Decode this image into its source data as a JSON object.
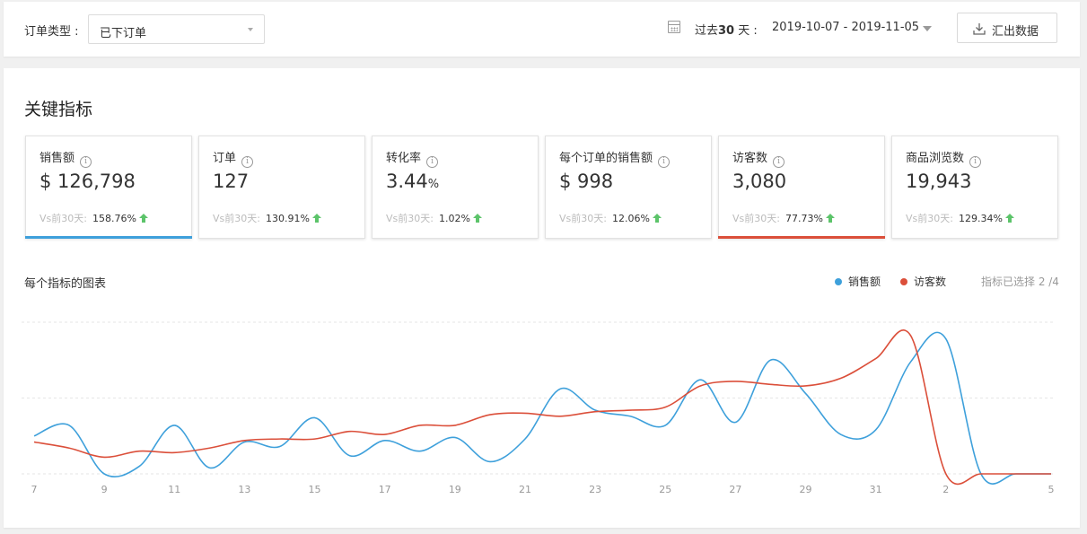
{
  "topbar": {
    "order_type_label": "订单类型 :",
    "order_type_value": "已下订单",
    "range_prefix": "过去",
    "range_days": "30",
    "range_suffix": " 天 :",
    "date_range": "2019-10-07 - 2019-11-05",
    "export_label": "汇出数据"
  },
  "section_title": "关键指标",
  "cards": [
    {
      "name": "销售额",
      "value": "$ 126,798",
      "unit": "",
      "compare_prefix": "Vs前30天:",
      "compare_pct": "158.76%",
      "selected": true,
      "accent": "#3ea0db"
    },
    {
      "name": "订单",
      "value": "127",
      "unit": "",
      "compare_prefix": "Vs前30天:",
      "compare_pct": "130.91%",
      "selected": false,
      "accent": ""
    },
    {
      "name": "转化率",
      "value": "3.44",
      "unit": "%",
      "compare_prefix": "Vs前30天:",
      "compare_pct": "1.02%",
      "selected": false,
      "accent": ""
    },
    {
      "name": "每个订单的销售额",
      "value": "$ 998",
      "unit": "",
      "compare_prefix": "Vs前30天:",
      "compare_pct": "12.06%",
      "selected": false,
      "accent": ""
    },
    {
      "name": "访客数",
      "value": "3,080",
      "unit": "",
      "compare_prefix": "Vs前30天:",
      "compare_pct": "77.73%",
      "selected": true,
      "accent": "#db4f3a"
    },
    {
      "name": "商品浏览数",
      "value": "19,943",
      "unit": "",
      "compare_prefix": "Vs前30天:",
      "compare_pct": "129.34%",
      "selected": false,
      "accent": ""
    }
  ],
  "colors": {
    "up_arrow": "#5cc46a",
    "sales": "#3ea0db",
    "visitors": "#db4f3a",
    "grid": "#e6e6e6"
  },
  "chart_title": "每个指标的图表",
  "selection_count": "指标已选择 2 /4",
  "chart_data": {
    "type": "line",
    "title": "每个指标的图表",
    "x": [
      "7",
      "8",
      "9",
      "10",
      "11",
      "12",
      "13",
      "14",
      "15",
      "16",
      "17",
      "18",
      "19",
      "20",
      "21",
      "22",
      "23",
      "24",
      "25",
      "26",
      "27",
      "28",
      "29",
      "30",
      "31",
      "1",
      "2",
      "3",
      "4",
      "5"
    ],
    "x_tick_labels": [
      "7",
      "9",
      "11",
      "13",
      "15",
      "17",
      "19",
      "21",
      "23",
      "25",
      "27",
      "29",
      "31",
      "2",
      "5"
    ],
    "ylim": [
      0,
      100
    ],
    "grid": true,
    "legend_position": "top-right",
    "y_axis_labels_shown": false,
    "series": [
      {
        "name": "销售额",
        "color": "#3ea0db",
        "values": [
          25,
          32,
          0,
          5,
          32,
          4,
          21,
          18,
          37,
          12,
          22,
          15,
          24,
          8,
          23,
          56,
          42,
          38,
          32,
          62,
          34,
          75,
          53,
          26,
          29,
          74,
          89,
          0,
          0,
          0
        ]
      },
      {
        "name": "访客数",
        "color": "#db4f3a",
        "values": [
          21,
          17,
          11,
          15,
          14,
          17,
          22,
          23,
          23,
          28,
          26,
          32,
          32,
          39,
          40,
          38,
          41,
          42,
          44,
          58,
          61,
          59,
          58,
          63,
          76,
          91,
          0,
          0,
          0,
          0
        ]
      }
    ]
  }
}
